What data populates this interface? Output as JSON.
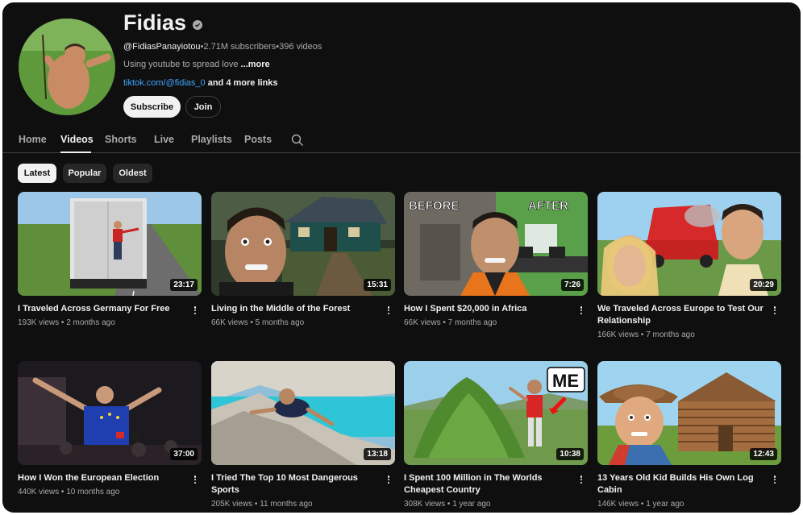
{
  "channel": {
    "name": "Fidias",
    "handle": "@FidiasPanayiotou",
    "subscribers": "2.71M subscribers",
    "videos_count": "396 videos",
    "separator": " • ",
    "description": "Using youtube to spread love ",
    "description_more": "...more",
    "link": "tiktok.com/@fidias_0",
    "more_links": " and 4 more links",
    "subscribe_label": "Subscribe",
    "join_label": "Join"
  },
  "tabs": [
    {
      "label": "Home"
    },
    {
      "label": "Videos",
      "active": true
    },
    {
      "label": "Shorts"
    },
    {
      "label": "Live"
    },
    {
      "label": "Playlists"
    },
    {
      "label": "Posts"
    }
  ],
  "chips": [
    {
      "label": "Latest",
      "selected": true
    },
    {
      "label": "Popular"
    },
    {
      "label": "Oldest"
    }
  ],
  "videos": [
    {
      "title": "I Traveled Across Germany For Free",
      "views": "193K views",
      "age": "2 months ago",
      "duration": "23:17"
    },
    {
      "title": "Living in the Middle of the Forest",
      "views": "66K views",
      "age": "5 months ago",
      "duration": "15:31"
    },
    {
      "title": "How I Spent $20,000 in Africa",
      "views": "66K views",
      "age": "7 months ago",
      "duration": "7:26",
      "thumb_text": [
        "BEFORE",
        "AFTER"
      ]
    },
    {
      "title": "We Traveled Across Europe to Test Our Relationship",
      "views": "166K views",
      "age": "7 months ago",
      "duration": "20:29"
    },
    {
      "title": "How I Won the European Election",
      "views": "440K views",
      "age": "10 months ago",
      "duration": "37:00"
    },
    {
      "title": "I Tried The Top 10 Most Dangerous Sports",
      "views": "205K views",
      "age": "11 months ago",
      "duration": "13:18"
    },
    {
      "title": "I Spent 100 Million in The Worlds Cheapest Country",
      "views": "308K views",
      "age": "1 year ago",
      "duration": "10:38",
      "thumb_text": [
        "ME"
      ]
    },
    {
      "title": "13 Years Old Kid Builds His Own Log Cabin",
      "views": "146K views",
      "age": "1 year ago",
      "duration": "12:43"
    }
  ],
  "colors": {
    "background": "#0f0f0f",
    "link": "#3ea6ff",
    "chip_selected": "#f1f1f1",
    "chip": "#272727"
  }
}
